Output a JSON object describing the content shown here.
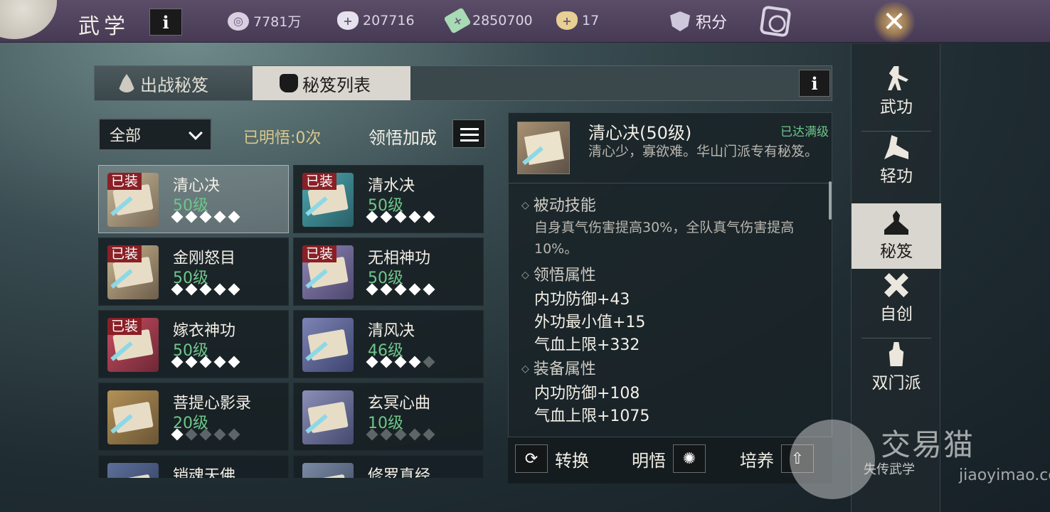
{
  "header": {
    "title": "武学",
    "info_label": "i",
    "currencies": [
      {
        "icon": "coin-stack-icon",
        "value": "7781万"
      },
      {
        "icon": "silver-ingot-icon",
        "value": "207716"
      },
      {
        "icon": "jade-ticket-icon",
        "value": "2850700"
      },
      {
        "icon": "gold-ingot-icon",
        "value": "17"
      }
    ],
    "points_label": "积分",
    "close_label": "✕"
  },
  "tabs": [
    {
      "label": "出战秘笈",
      "active": false
    },
    {
      "label": "秘笈列表",
      "active": true
    }
  ],
  "tabs_info_label": "i",
  "filter": {
    "value": "全部"
  },
  "enlight_count": "已明悟:0次",
  "bonus_label": "领悟加成",
  "cards": [
    {
      "name": "清心决",
      "level": "50级",
      "stars": 5,
      "max_stars": 5,
      "equipped": true,
      "equip_label": "已装",
      "selected": true
    },
    {
      "name": "清水决",
      "level": "50级",
      "stars": 5,
      "max_stars": 5,
      "equipped": true,
      "equip_label": "已装",
      "selected": false
    },
    {
      "name": "金刚怒目",
      "level": "50级",
      "stars": 5,
      "max_stars": 5,
      "equipped": true,
      "equip_label": "已装",
      "selected": false
    },
    {
      "name": "无相神功",
      "level": "50级",
      "stars": 5,
      "max_stars": 5,
      "equipped": true,
      "equip_label": "已装",
      "selected": false
    },
    {
      "name": "嫁衣神功",
      "level": "50级",
      "stars": 5,
      "max_stars": 5,
      "equipped": true,
      "equip_label": "已装",
      "selected": false
    },
    {
      "name": "清风决",
      "level": "46级",
      "stars": 4,
      "max_stars": 5,
      "equipped": false,
      "equip_label": "",
      "selected": false
    },
    {
      "name": "菩提心影录",
      "level": "20级",
      "stars": 1,
      "max_stars": 5,
      "equipped": false,
      "equip_label": "",
      "selected": false
    },
    {
      "name": "玄冥心曲",
      "level": "10级",
      "stars": 0,
      "max_stars": 5,
      "equipped": false,
      "equip_label": "",
      "selected": false
    },
    {
      "name": "销魂天佛",
      "level": "",
      "stars": 0,
      "max_stars": 0,
      "equipped": false,
      "equip_label": "",
      "selected": false
    },
    {
      "name": "修罗真经",
      "level": "",
      "stars": 0,
      "max_stars": 0,
      "equipped": false,
      "equip_label": "",
      "selected": false
    }
  ],
  "detail": {
    "title": "清心决(50级)",
    "max_label": "已达满级",
    "desc": "清心少，寡欲难。华山门派专有秘笈。",
    "passive_title": "被动技能",
    "passive_text": "自身真气伤害提高30%，全队真气伤害提高10%。",
    "enlight_title": "领悟属性",
    "enlight_stats": [
      "内功防御+43",
      "外功最小值+15",
      "气血上限+332"
    ],
    "equip_title": "装备属性",
    "equip_stats": [
      "内功防御+108",
      "气血上限+1075"
    ]
  },
  "actions": {
    "convert": "转换",
    "enlight": "明悟",
    "cultivate": "培养"
  },
  "sidebar": [
    {
      "label": "武功",
      "icon": "martial-stance-icon",
      "active": false
    },
    {
      "label": "轻功",
      "icon": "leaping-figure-icon",
      "active": false
    },
    {
      "label": "秘笈",
      "icon": "meditation-icon",
      "active": true
    },
    {
      "label": "自创",
      "icon": "crossed-swords-icon",
      "active": false
    },
    {
      "label": "双门派",
      "icon": "swordsman-icon",
      "active": false
    }
  ],
  "watermark": {
    "brand": "交易猫",
    "game": "失传武学",
    "url": "jiaoyimao.com"
  },
  "colors": {
    "level_green": "#6ec68a",
    "equip_red": "#8a1f26",
    "gold_text": "#d8c88d"
  }
}
